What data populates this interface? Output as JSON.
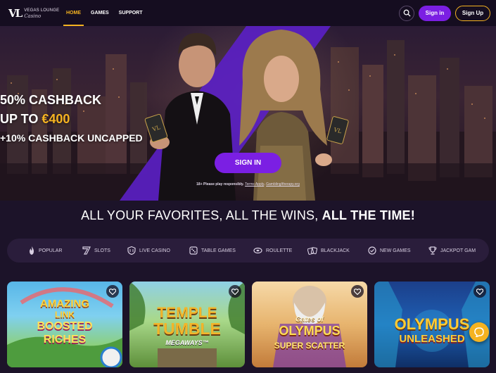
{
  "header": {
    "logo_line1": "VEGAS LOUNGE",
    "logo_line2": "Casino",
    "logo_mark": "VL",
    "nav": [
      {
        "label": "HOME",
        "active": true
      },
      {
        "label": "GAMES",
        "active": false
      },
      {
        "label": "SUPPORT",
        "active": false
      }
    ],
    "signin_label": "Sign in",
    "signup_label": "Sign Up"
  },
  "hero": {
    "line1": "50% CASHBACK",
    "line2_prefix": "UP TO ",
    "line2_amount": "€400",
    "line3": "+10% CASHBACK UNCAPPED",
    "cta_label": "SIGN IN",
    "disclaimer_prefix": "18+ Please play responsibly. ",
    "disclaimer_terms": "Terms Apply",
    "disclaimer_sep": ". ",
    "disclaimer_link": "Gambling/therapy.org",
    "card_mark": "VL"
  },
  "tagline": {
    "light": "ALL YOUR FAVORITES, ALL THE WINS, ",
    "bold": "ALL THE TIME!"
  },
  "categories": [
    {
      "label": "POPULAR",
      "icon": "flame-icon"
    },
    {
      "label": "SLOTS",
      "icon": "seven-icon"
    },
    {
      "label": "LIVE CASINO",
      "icon": "shield-icon"
    },
    {
      "label": "TABLE GAMES",
      "icon": "dice-icon"
    },
    {
      "label": "ROULETTE",
      "icon": "roulette-icon"
    },
    {
      "label": "BLACKJACK",
      "icon": "cards-icon"
    },
    {
      "label": "NEW GAMES",
      "icon": "badge-check-icon"
    },
    {
      "label": "JACKPOT GAM",
      "icon": "trophy-icon"
    }
  ],
  "games": [
    {
      "line1": "AMAZING",
      "line2": "LINK",
      "line3": "BOOSTED",
      "line4": "RICHES"
    },
    {
      "line1": "TEMPLE",
      "line2": "TUMBLE",
      "line3": "MEGAWAYS™"
    },
    {
      "line1": "Gates of",
      "line2": "OLYMPUS",
      "line3": "SUPER SCATTER"
    },
    {
      "line1": "OLYMPUS",
      "line2": "UNLEASHED"
    }
  ],
  "colors": {
    "accent_gold": "#f5b321",
    "brand_purple": "#7b1fe3",
    "background": "#1c1329"
  }
}
